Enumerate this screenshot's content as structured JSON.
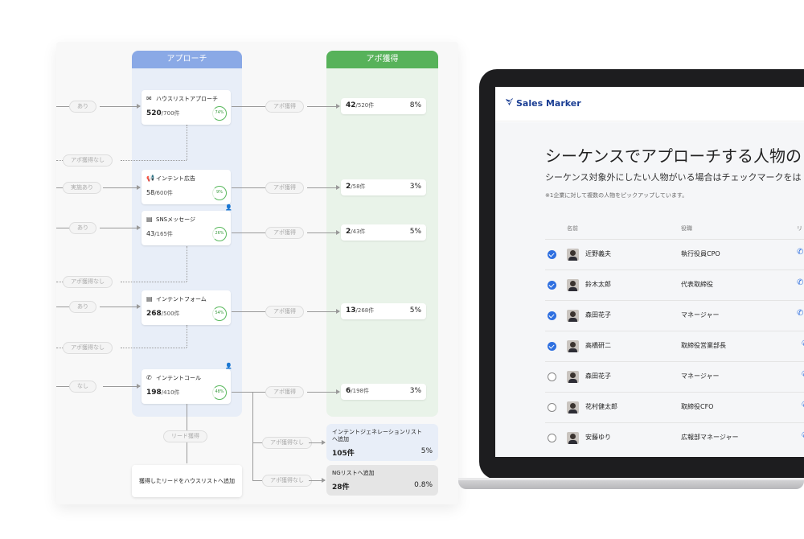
{
  "flow": {
    "approach_header": "アプローチ",
    "apo_header": "アポ獲得",
    "nodes": [
      {
        "title": "ハウスリストアプローチ",
        "count": "520",
        "total": "/700件",
        "pct": "74%",
        "icon": "mail-icon"
      },
      {
        "title": "インテント広告",
        "count": "58",
        "total": "/600件",
        "pct": "9%",
        "icon": "megaphone-icon"
      },
      {
        "title": "SNSメッセージ",
        "count": "43",
        "total": "/165件",
        "pct": "26%",
        "icon": "message-icon"
      },
      {
        "title": "インテントフォーム",
        "count": "268",
        "total": "/500件",
        "pct": "54%",
        "icon": "form-icon"
      },
      {
        "title": "インテントコール",
        "count": "198",
        "total": "/410件",
        "pct": "48%",
        "icon": "phone-icon"
      }
    ],
    "results": [
      {
        "value": "42",
        "total": "/520件",
        "pct": "8%"
      },
      {
        "value": "2",
        "total": "/58件",
        "pct": "3%"
      },
      {
        "value": "2",
        "total": "/43件",
        "pct": "5%"
      },
      {
        "value": "13",
        "total": "/268件",
        "pct": "5%"
      },
      {
        "value": "6",
        "total": "/198件",
        "pct": "3%"
      }
    ],
    "left_labels": [
      "あり",
      "実施あり",
      "あり",
      "あり",
      "なし"
    ],
    "no_apo_labels": [
      "アポ獲得なし",
      "アポ獲得なし",
      "アポ獲得なし"
    ],
    "apo_label": "アポ獲得",
    "apo_none_label": "アポ獲得なし",
    "lead_label": "リード獲得",
    "lead_box": "獲得したリードをハウスリストへ追加",
    "intent_gen": {
      "title": "インテントジェネレーションリスト\nへ追加",
      "value": "105件",
      "pct": "5%"
    },
    "ng_list": {
      "title": "NGリストへ追加",
      "value": "28件",
      "pct": "0.8%"
    }
  },
  "app": {
    "logo": "Sales Marker",
    "title": "シーケンスでアプローチする人物のリ",
    "subtitle": "シーケンス対象外にしたい人物がいる場合はチェックマークをは",
    "note": "※1企業に対して複数の人物をピックアップしています。",
    "col_name": "名前",
    "col_role": "役職",
    "col_extra": "リ",
    "people": [
      {
        "name": "近野義夫",
        "role": "執行役員CPO",
        "checked": true
      },
      {
        "name": "鈴木太郎",
        "role": "代表取締役",
        "checked": true
      },
      {
        "name": "森田花子",
        "role": "マネージャー",
        "checked": true
      },
      {
        "name": "高橋研二",
        "role": "取締役営業部長",
        "checked": true
      },
      {
        "name": "森田花子",
        "role": "マネージャー",
        "checked": false
      },
      {
        "name": "花村健太郎",
        "role": "取締役CFO",
        "checked": false
      },
      {
        "name": "安藤ゆり",
        "role": "広報部マネージャー",
        "checked": false
      }
    ]
  }
}
